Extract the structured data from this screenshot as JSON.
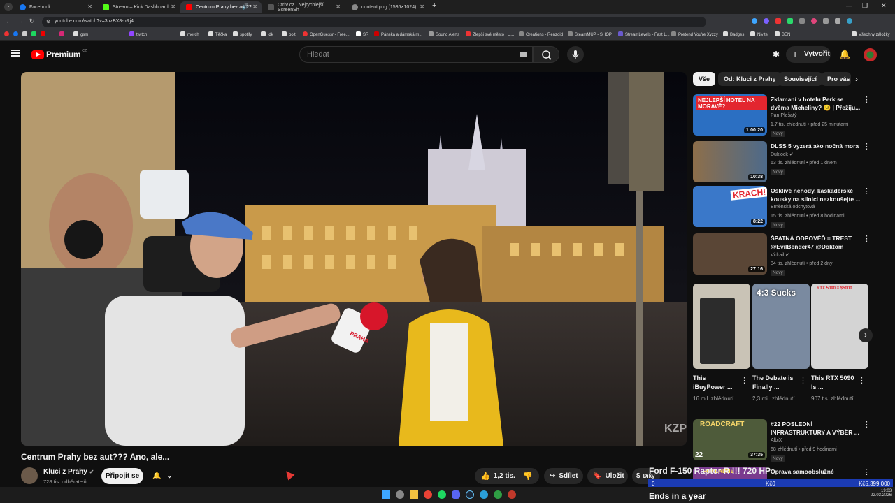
{
  "browser": {
    "tabs": [
      {
        "title": "Facebook",
        "color": "#1877f2"
      },
      {
        "title": "Stream – Kick Dashboard",
        "color": "#53fc18"
      },
      {
        "title": "Centrum Prahy bez aut?? ",
        "color": "#ff0000"
      },
      {
        "title": "CtrlV.cz | Nejrychlejší ScreenSh",
        "color": "#555555"
      },
      {
        "title": "content.png (1536×1024)",
        "color": "#888888"
      }
    ],
    "url": "youtube.com/watch?v=3uzBX8-oRj4",
    "bookmarks": [
      "gsm",
      "merch",
      "Těčka",
      "spotify",
      "idk",
      "bolt",
      "OpenGuessr - Free...",
      "SR",
      "Pánská a dámská m...",
      "Sound Alerts",
      "Zlepši své město | U...",
      "Creations - Renzoid",
      "SteamMUP - SHOP",
      "StreamLevels - Fast L...",
      "Pretend You're Xyzzy",
      "Badges",
      "Nivite",
      "BEN",
      "Všechny záložky"
    ],
    "bookmark_icons": [
      "twitch-icon"
    ]
  },
  "youtube": {
    "logo_text": "Premium",
    "logo_suffix": "CZ",
    "search_placeholder": "Hledat",
    "create_label": "Vytvořit"
  },
  "video": {
    "title": "Centrum Prahy bez aut??? Ano, ale...",
    "channel": "Kluci z Prahy",
    "subscribers": "728 tis. odběratelů",
    "join_label": "Připojit se",
    "likes": "1,2 tis.",
    "share_label": "Sdílet",
    "save_label": "Uložit",
    "gift_label": "Díky",
    "watermark": "KZP",
    "mic_text": "PRAHA"
  },
  "chips": [
    "Vše",
    "Od: Kluci z Prahy",
    "Související",
    "Pro vás"
  ],
  "recommendations": [
    {
      "title": "Zklamaní v hotelu Perk se dvěma Micheliny? 😕 | Přežiju...",
      "channel": "Pan Plešatý",
      "meta": "1,7 tis. zhlédnutí • před 25 minutami",
      "badge": "Nový",
      "duration": "1:00:20",
      "thumb_text": "NEJLEPŠÍ HOTEL NA MORAVĚ?",
      "color": "#2b6fc2"
    },
    {
      "title": "DLSS 5 vyzerá ako nočná mora",
      "channel": "Duklock",
      "meta": "63 tis. zhlédnutí • před 1 dnem",
      "badge": "Nový",
      "duration": "10:38",
      "thumb_text": "",
      "color": "#6a5a3a"
    },
    {
      "title": "Ošklivé nehody, kaskadérské kousky na silnici nezkoušejte ...",
      "channel": "Brněnská odchytová",
      "meta": "15 tis. zhlédnutí • před 8 hodinami",
      "badge": "Nový",
      "duration": "8:22",
      "thumb_text": "KRACH!",
      "color": "#3a78c9"
    },
    {
      "title": "ŠPATNÁ ODPOVĚĎ = TREST @EvilBender47 @Doktom",
      "channel": "Vidrail",
      "meta": "84 tis. zhlédnutí • před 2 dny",
      "badge": "Nový",
      "duration": "27:16",
      "thumb_text": "",
      "color": "#5a4636"
    }
  ],
  "shorts": [
    {
      "title": "This iBuyPower ...",
      "views": "16 mil. zhlédnutí",
      "thumb_text": "",
      "color": "#c9c3b6"
    },
    {
      "title": "The Debate is Finally ...",
      "views": "2,3 mil. zhlédnutí",
      "thumb_text": "4:3 Sucks",
      "color": "#7a8aa0"
    },
    {
      "title": "This RTX 5090 Is ...",
      "views": "907 tis. zhlédnutí",
      "thumb_text": "RTX 5090 = $5000",
      "color": "#d4d4d4"
    }
  ],
  "recommendations2": [
    {
      "title": "#22 POSLEDNÍ INFRASTRUKTURY A VÝBĚR ...",
      "channel": "AlbiX",
      "meta": "68 zhlédnutí • před 9 hodinami",
      "badge": "Nový",
      "duration": "37:35",
      "thumb_text": "ROADCRAFT",
      "extra": "22",
      "color": "#4e5b3a"
    },
    {
      "title": "Oprava samoobslužné",
      "duration": "",
      "thumb_text": "POKLADNE",
      "color": "#7a3b8e"
    }
  ],
  "overlay": {
    "ticker": "Ford F-150 Raptor R !!! 720 HP",
    "market_left": "0",
    "market_mid": "Kč0",
    "market_right": "Kč5,399,000",
    "ends": "Ends in a year"
  },
  "taskbar": {
    "time": "19:03",
    "date": "22.03.2026"
  }
}
